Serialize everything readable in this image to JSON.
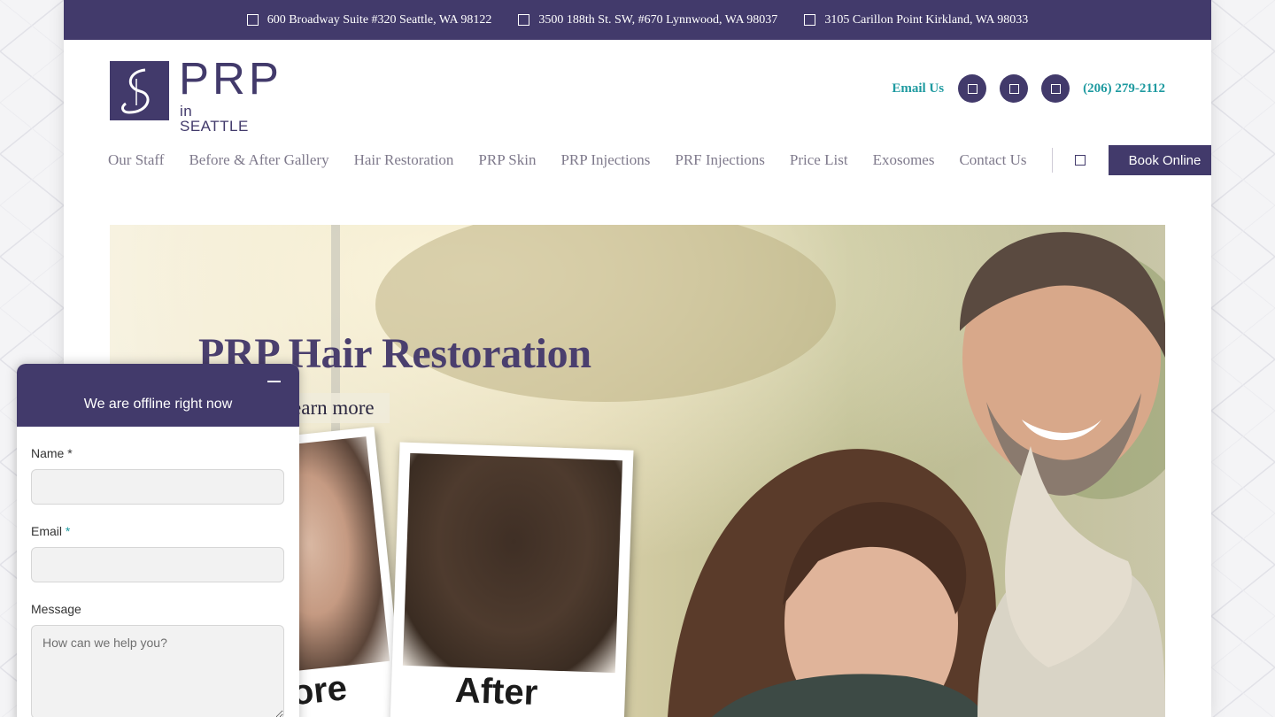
{
  "topbar": {
    "locations": [
      "600 Broadway Suite #320 Seattle, WA 98122",
      "3500 188th St. SW, #670 Lynnwood, WA 98037",
      "3105 Carillon Point Kirkland, WA 98033"
    ],
    "icon": "map-pin-icon"
  },
  "logo": {
    "text": "PRP",
    "subtext": "in SEATTLE"
  },
  "header": {
    "email_label": "Email Us",
    "social_icons": [
      "facebook-icon",
      "instagram-icon",
      "youtube-icon"
    ],
    "phone": "(206) 279-2112"
  },
  "nav": {
    "items": [
      "Our Staff",
      "Before & After Gallery",
      "Hair Restoration",
      "PRP Skin",
      "PRP Injections",
      "PRF Injections",
      "Price List",
      "Exosomes",
      "Contact Us"
    ],
    "search_icon": "search-icon",
    "book_label": "Book Online"
  },
  "hero": {
    "title": "PRP Hair Restoration",
    "button_label": "Learn more",
    "before_label": "Before",
    "after_label": "After"
  },
  "chat": {
    "title": "We are offline right now",
    "name_label": "Name",
    "email_label": "Email",
    "message_label": "Message",
    "required_mark": "*",
    "message_placeholder": "How can we help you?"
  },
  "colors": {
    "brand_purple": "#423a6b",
    "accent_teal": "#1e9aa0"
  }
}
